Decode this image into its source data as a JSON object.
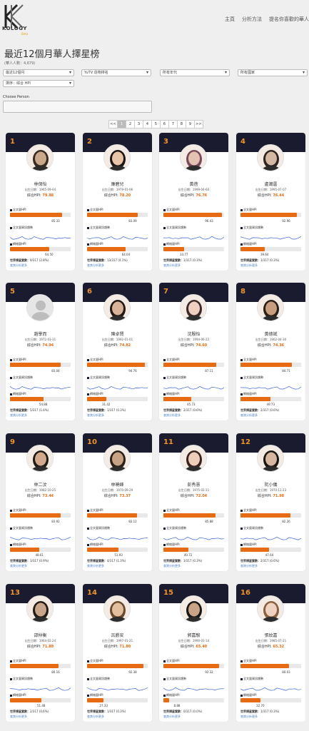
{
  "brand": {
    "name": "KOLOGY",
    "sub": "Beta"
  },
  "nav": [
    "主頁",
    "分析方法",
    "提名你喜歡的華人"
  ],
  "title": "最近12個月華人擇星榜",
  "subtitle": "(華人人數：4,679)",
  "filters": {
    "period": "最近12個月",
    "platform": "YuTV 造物排名",
    "age": "所有年代",
    "region": "所有國家",
    "sort": "排序：综合 HPI"
  },
  "choose_person": {
    "label": "Choose Person",
    "value": ""
  },
  "pagination": [
    "<<",
    "1",
    "2",
    "3",
    "4",
    "5",
    "6",
    "7",
    "8",
    "9",
    ">>"
  ],
  "pagination_active": 1,
  "labels": {
    "dob": "出生日期：",
    "hpi": "綜合HPI: ",
    "bar1": "全文量HPI",
    "spark": "全文量資訊趨勢",
    "bar2": "網絡量HPI",
    "world": "世界擇星實數：",
    "link": "查詢分析更多"
  },
  "colors": {
    "accent": "#e66b12",
    "dark": "#1b1b2f",
    "rank": "#f0932b",
    "spark": "#3f64d6"
  },
  "cards": [
    {
      "rank": "1",
      "name": "林保怡",
      "dob": "1965-09-04",
      "hpi": "79.88",
      "v1": 85.33,
      "v2": 64.5,
      "world": "9/317 (2.8%)",
      "av": "#c9a98a",
      "hair": "#3a2b22"
    },
    {
      "rank": "2",
      "name": "廉碧兒",
      "dob": "1979-01-06",
      "hpi": "78.20",
      "v1": 83.09,
      "v2": 64.04,
      "world": "13/317 (4.1%)",
      "av": "#e8c4a8",
      "hair": "#1c1614"
    },
    {
      "rank": "3",
      "name": "黃蓓",
      "dob": "1999-04-60",
      "hpi": "76.76",
      "v1": 96.43,
      "v2": 33.77,
      "world": "1/317 (0.3%)",
      "av": "#e5c3b3",
      "hair": "#7a4a5a"
    },
    {
      "rank": "4",
      "name": "盧瀚霆",
      "dob": "1995-07-07",
      "hpi": "76.44",
      "v1": 92.96,
      "v2": 39.64,
      "world": "1/317 (0.3%)",
      "av": "#d3b9a3",
      "hair": "#2e2420"
    },
    {
      "rank": "5",
      "name": "趙學而",
      "dob": "1972-03-31",
      "hpi": "74.94",
      "v1": 83.04,
      "v2": 54.88,
      "world": "5/317 (1.6%)",
      "av": "#dcdcdc",
      "hair": "#bfbfbf"
    },
    {
      "rank": "6",
      "name": "陳卓賢",
      "dob": "1992-01-01",
      "hpi": "74.82",
      "v1": 94.76,
      "v2": 31.42,
      "world": "1/317 (0.3%)",
      "av": "#d9b29a",
      "hair": "#221a16"
    },
    {
      "rank": "7",
      "name": "沈殷怡",
      "dob": "1994-06-22",
      "hpi": "74.60",
      "v1": 87.11,
      "v2": 45.73,
      "world": "2/317 (0.6%)",
      "av": "#efd0c0",
      "hair": "#3b2a2a"
    },
    {
      "rank": "8",
      "name": "黃德斌",
      "dob": "1962-04-30",
      "hpi": "74.36",
      "v1": 84.71,
      "v2": 49.73,
      "world": "2/317 (0.6%)",
      "av": "#c99e7e",
      "hair": "#2b2018"
    },
    {
      "rank": "9",
      "name": "林二汶",
      "dob": "1982-10-25",
      "hpi": "73.44",
      "v1": 83.92,
      "v2": 48.61,
      "world": "3/317 (0.9%)",
      "av": "#d2a98a",
      "hair": "#1e1a16"
    },
    {
      "rank": "10",
      "name": "林曉峰",
      "dob": "1970-09-29",
      "hpi": "73.37",
      "v1": 82.12,
      "v2": 51.93,
      "world": "4/317 (1.3%)",
      "av": "#c8a285",
      "hair": "#2a2018"
    },
    {
      "rank": "11",
      "name": "彭秀慧",
      "dob": "1975-02-11",
      "hpi": "72.04",
      "v1": 85.88,
      "v2": 40.72,
      "world": "1/317 (0.3%)",
      "av": "#edcdbb",
      "hair": "#3a2420"
    },
    {
      "rank": "12",
      "name": "阮小儀",
      "dob": "1970-11-23",
      "hpi": "71.98",
      "v1": 82.26,
      "v2": 47.64,
      "world": "2/317 (0.6%)",
      "av": "#d8b7a1",
      "hair": "#1a1614"
    },
    {
      "rank": "13",
      "name": "邵仲衡",
      "dob": "1964-02-24",
      "hpi": "71.89",
      "v1": 80.16,
      "v2": 51.48,
      "world": "2/317 (0.6%)",
      "av": "#c9a689",
      "hair": "#241c18"
    },
    {
      "rank": "14",
      "name": "呂爵安",
      "dob": "1997-01-21",
      "hpi": "71.80",
      "v1": 92.38,
      "v2": 27.33,
      "world": "1/317 (0.3%)",
      "av": "#e2bf9f",
      "hair": "#6b4a2c"
    },
    {
      "rank": "15",
      "name": "郭嘉駿",
      "dob": "1990-01-14",
      "hpi": "65.40",
      "v1": 92.32,
      "v2": 8.88,
      "world": "0/317 (0.0%)",
      "av": "#caa487",
      "hair": "#181818"
    },
    {
      "rank": "16",
      "name": "張紋嘉",
      "dob": "1985-07-21",
      "hpi": "65.32",
      "v1": 80.03,
      "v2": 32.7,
      "world": "1/317 (0.3%)",
      "av": "#f0d2c0",
      "hair": "#8a6040"
    }
  ]
}
